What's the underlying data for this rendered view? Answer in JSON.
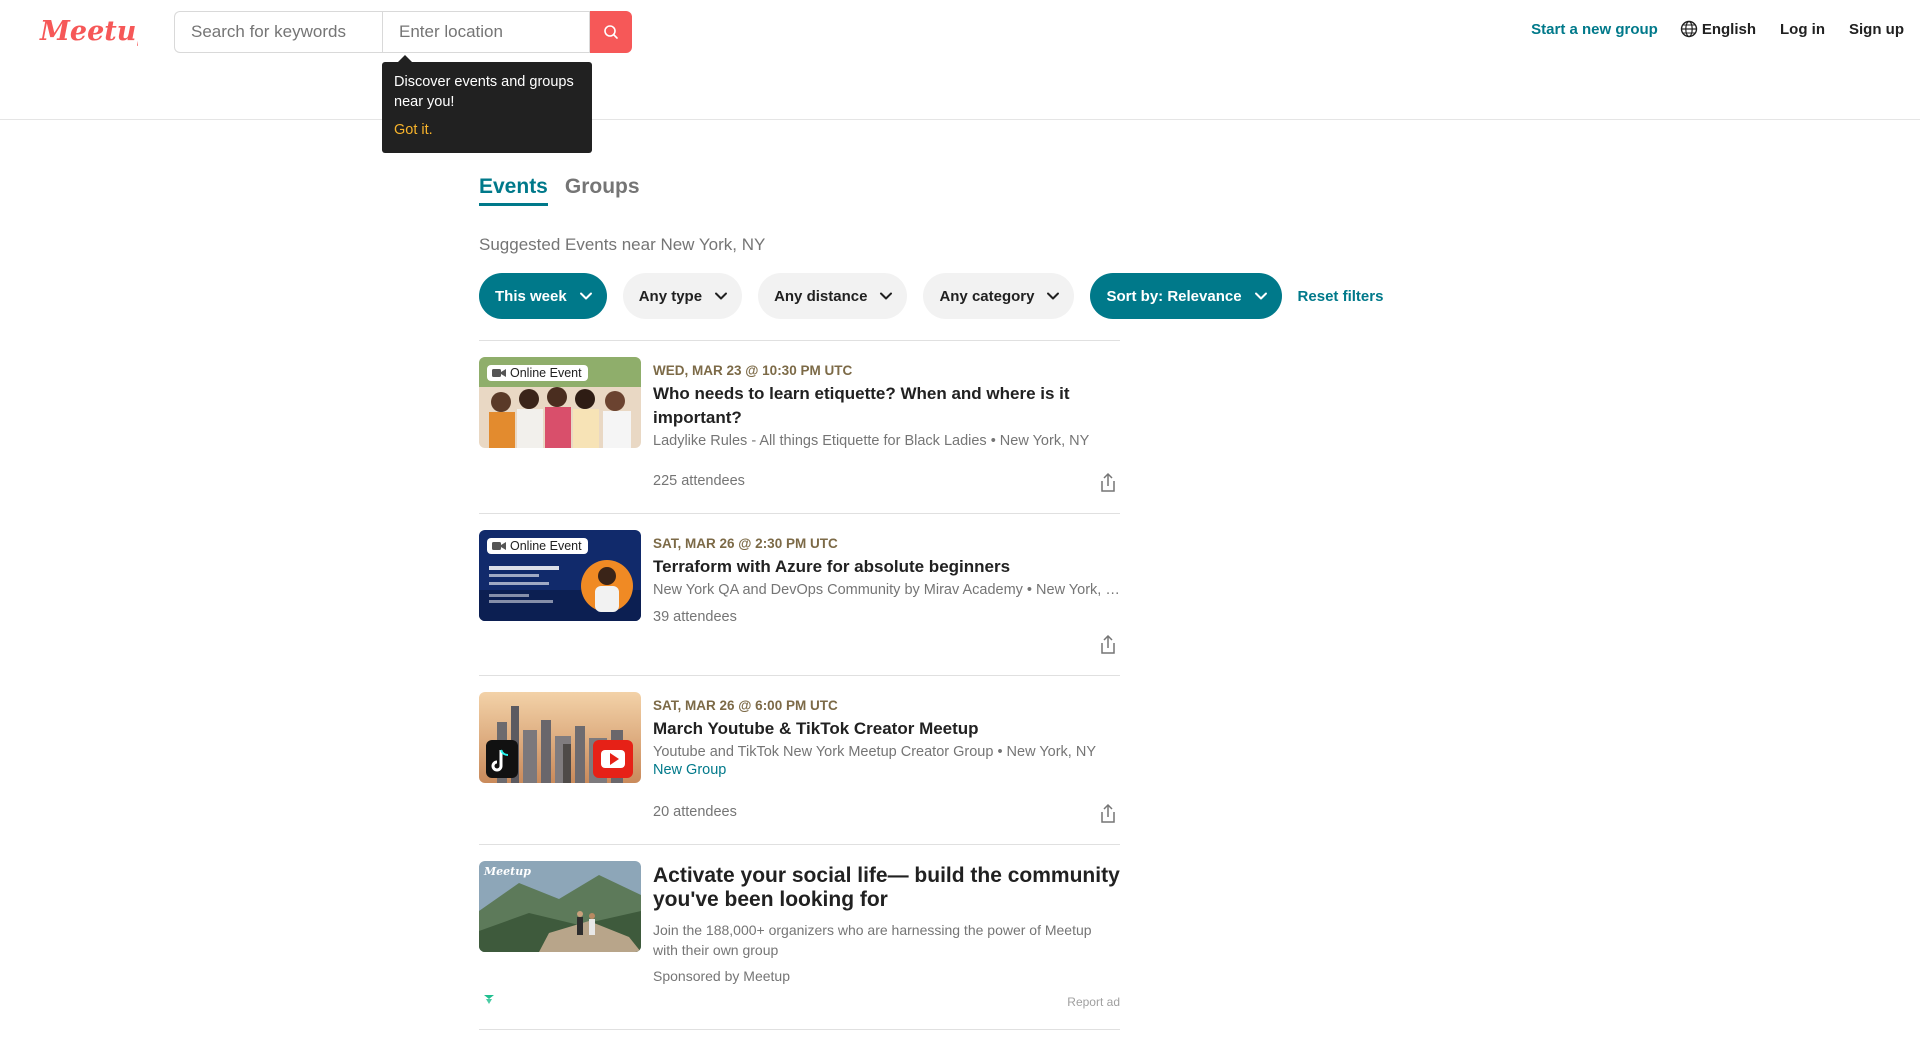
{
  "header": {
    "logo_text": "Meetup",
    "search_placeholder": "Search for keywords",
    "location_placeholder": "Enter location",
    "start_group": "Start a new group",
    "language": "English",
    "login": "Log in",
    "signup": "Sign up"
  },
  "tooltip": {
    "text": "Discover events and groups near you!",
    "action": "Got it."
  },
  "tabs": [
    {
      "label": "Events",
      "active": true
    },
    {
      "label": "Groups",
      "active": false
    }
  ],
  "suggested_text": "Suggested Events near New York, NY",
  "filters": {
    "when": "This week",
    "type": "Any type",
    "distance": "Any distance",
    "category": "Any category",
    "sort": "Sort by: Relevance",
    "reset": "Reset filters"
  },
  "events": [
    {
      "date": "WED, MAR 23 @ 10:30 PM UTC",
      "title": "Who needs to learn etiquette? When and where is it important?",
      "group": "Ladylike Rules - All things Etiquette for Black Ladies • New York, NY",
      "badge": "Online Event",
      "attendees": "225 attendees"
    },
    {
      "date": "SAT, MAR 26 @ 2:30 PM UTC",
      "title": "Terraform with Azure for absolute beginners",
      "group": "New York QA and DevOps Community by Mirav Academy • New York, NY",
      "badge": "Online Event",
      "attendees": "39 attendees"
    },
    {
      "date": "SAT, MAR 26 @ 6:00 PM UTC",
      "title": "March Youtube & TikTok Creator Meetup",
      "group": "Youtube and TikTok New York Meetup Creator Group • New York, NY",
      "new_group": "New Group",
      "attendees": "20 attendees"
    }
  ],
  "ad": {
    "title": "Activate your social life— build the community you've been looking for",
    "description": "Join the 188,000+ organizers who are harnessing the power of Meetup with their own group",
    "sponsor": "Sponsored by Meetup",
    "report": "Report ad",
    "thumb_logo": "Meetup"
  },
  "colors": {
    "brand_red": "#f65858",
    "teal": "#00798a",
    "date_brown": "#7c6a47",
    "tooltip_bg": "#212121",
    "tooltip_action": "#f7b32b"
  }
}
